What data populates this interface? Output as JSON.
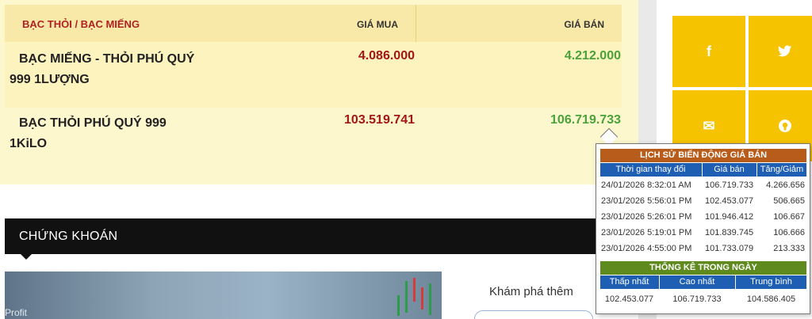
{
  "silver_table": {
    "header": {
      "name": "BẠC THỎI / BẠC MIẾNG",
      "buy": "GIÁ MUA",
      "sell": "GIÁ BÁN"
    },
    "rows": [
      {
        "name": "BẠC MIẾNG - THỎI PHÚ QUÝ 999 1LƯỢNG",
        "buy": "4.086.000",
        "sell": "4.212.000"
      },
      {
        "name": "BẠC THỎI PHÚ QUÝ 999 1KiLO",
        "buy": "103.519.741",
        "sell": "106.719.733"
      }
    ]
  },
  "stock": {
    "title": "CHỨNG KHOÁN",
    "image_caption": "Profit"
  },
  "explore": {
    "label": "Khám phá thêm"
  },
  "social": {
    "facebook_icon": "f",
    "twitter_icon": "t",
    "mail_icon": "✉",
    "github_icon": "●"
  },
  "tooltip": {
    "history_title": "LỊCH SỬ BIẾN ĐỘNG GIÁ BÁN",
    "history_columns": [
      "Thời gian thay đổi",
      "Giá bán",
      "Tăng/Giảm"
    ],
    "history_rows": [
      {
        "time": "24/01/2026 8:32:01 AM",
        "price": "106.719.733",
        "change": "4.266.656"
      },
      {
        "time": "23/01/2026 5:56:01 PM",
        "price": "102.453.077",
        "change": "506.665"
      },
      {
        "time": "23/01/2026 5:26:01 PM",
        "price": "101.946.412",
        "change": "106.667"
      },
      {
        "time": "23/01/2026 5:19:01 PM",
        "price": "101.839.745",
        "change": "106.666"
      },
      {
        "time": "23/01/2026 4:55:00 PM",
        "price": "101.733.079",
        "change": "213.333"
      }
    ],
    "stats_title": "THỐNG KÊ TRONG NGÀY",
    "stats_columns": [
      "Thấp nhất",
      "Cao nhất",
      "Trung bình"
    ],
    "stats_values": [
      "102.453.077",
      "106.719.733",
      "104.586.405"
    ]
  },
  "colors": {
    "buy": "#a31616",
    "sell": "#4aa23a",
    "header_text": "#b02222",
    "social_bg": "#f5c300",
    "history_bar": "#b85c1c",
    "stats_bar": "#5e8a1e",
    "column_bar": "#1f5fb3"
  }
}
